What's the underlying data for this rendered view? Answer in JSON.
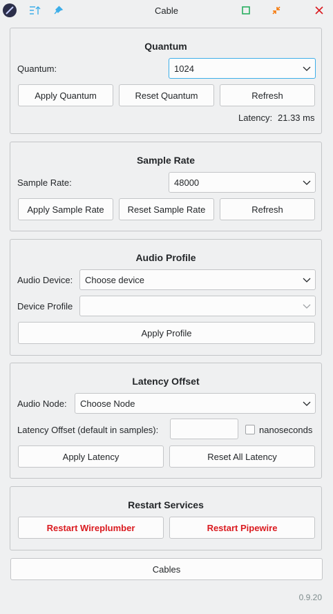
{
  "window": {
    "title": "Cable",
    "icons": [
      "app-logo-icon",
      "sort-icon",
      "pin-icon",
      "maximize-icon",
      "minimize-icon",
      "close-icon"
    ],
    "accent_green": "#27ae60",
    "accent_orange": "#f67400",
    "accent_red": "#da1a1f",
    "accent_blue": "#3daee9"
  },
  "quantum": {
    "title": "Quantum",
    "label": "Quantum:",
    "value": "1024",
    "apply_label": "Apply Quantum",
    "reset_label": "Reset Quantum",
    "refresh_label": "Refresh",
    "latency_label": "Latency:",
    "latency_value": "21.33 ms"
  },
  "sample_rate": {
    "title": "Sample Rate",
    "label": "Sample Rate:",
    "value": "48000",
    "apply_label": "Apply Sample Rate",
    "reset_label": "Reset Sample Rate",
    "refresh_label": "Refresh"
  },
  "audio_profile": {
    "title": "Audio Profile",
    "device_label": "Audio Device:",
    "device_value": "Choose device",
    "profile_label": "Device Profile",
    "profile_value": "",
    "apply_label": "Apply Profile"
  },
  "latency_offset": {
    "title": "Latency Offset",
    "node_label": "Audio Node:",
    "node_value": "Choose Node",
    "offset_label": "Latency Offset (default in samples):",
    "offset_value": "",
    "nanoseconds_label": "nanoseconds",
    "nanoseconds_checked": false,
    "apply_label": "Apply Latency",
    "reset_label": "Reset All Latency"
  },
  "restart": {
    "title": "Restart Services",
    "wireplumber_label": "Restart Wireplumber",
    "pipewire_label": "Restart Pipewire"
  },
  "footer": {
    "cables_label": "Cables",
    "version": "0.9.20"
  }
}
